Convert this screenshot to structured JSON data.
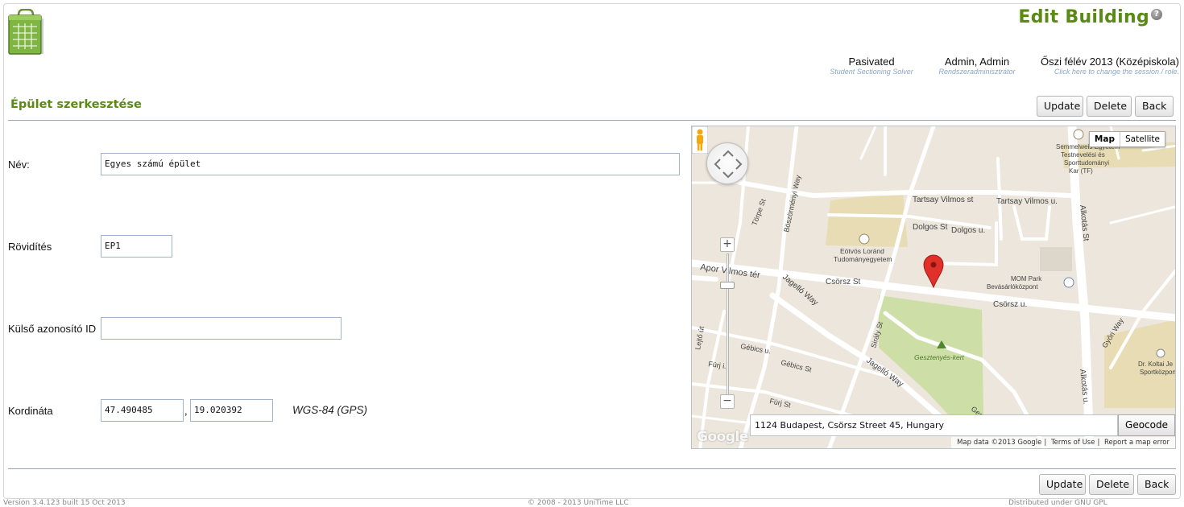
{
  "header": {
    "title": "Edit Building",
    "help_icon": "?",
    "blocks": [
      {
        "main": "Pasivated",
        "sub": "Student Sectioning Solver"
      },
      {
        "main": "Admin, Admin",
        "sub": "Rendszeradminisztrátor"
      },
      {
        "main": "Őszi félév 2013 (Középiskola)",
        "sub": "Click here to change the session / role."
      }
    ]
  },
  "section": {
    "title": "Épület szerkesztése"
  },
  "buttons": {
    "update": "Update",
    "delete": "Delete",
    "back": "Back"
  },
  "form": {
    "name_label": "Név:",
    "name_value": "Egyes számú épület",
    "abbr_label": "Rövidítés",
    "abbr_value": "EP1",
    "external_id_label": "Külső azonosító ID",
    "external_id_value": "",
    "coord_label": "Kordináta",
    "lat_value": "47.490485",
    "lng_value": "19.020392",
    "coord_separator": ",",
    "coord_system": "WGS-84 (GPS)"
  },
  "map": {
    "type_map": "Map",
    "type_satellite": "Satellite",
    "geocode_value": "1124 Budapest, Csörsz Street 45, Hungary",
    "geocode_button": "Geocode",
    "watermark": "Google",
    "attribution": [
      "Map data ©2013 Google",
      "Terms of Use",
      "Report a map error"
    ],
    "labels": {
      "tartsay1": "Tartsay Vilmos st",
      "tartsay2": "Tartsay Vilmos u.",
      "dolgos1": "Dolgos St",
      "dolgos2": "Dolgos u.",
      "alkotas1": "Alkotás St",
      "alkotas2": "Alkotás u.",
      "csorsz1": "Csörsz St",
      "csorsz2": "Csörsz u.",
      "apor": "Apor Vilmos tér",
      "jagello1": "Jagelló Way",
      "jagello2": "Jagelló Way",
      "boszormenyi": "Böszörményi Way",
      "torpe": "Törpe St",
      "gebics1": "Gébics u.",
      "gebics2": "Gébics St",
      "furj1": "Fürj i.",
      "furj2": "Fürj St",
      "siraly": "Sirály St",
      "gyori": "Győri Way",
      "gesztenyes_kert": "Gesztenyés-kert",
      "gesztenyes": "Gesztenyés",
      "elte1": "Eötvös Loránd",
      "elte2": "Tudományegyetem",
      "mom1": "MOM Park",
      "mom2": "Bevásárlóközpont",
      "semm1": "Semmelweis Egyetem",
      "semm2": "Testnevelési és",
      "semm3": "Sporttudományi",
      "semm4": "Kar (TF)",
      "koltai1": "Dr. Koltai Je",
      "koltai2": "Sportközpon",
      "lejto": "Lejtő út"
    }
  },
  "footer": {
    "left": "Version 3.4.123 built 15 Oct 2013",
    "center": "© 2008 - 2013 UniTime LLC",
    "right": "Distributed under GNU GPL"
  },
  "colors": {
    "title_green": "#5a8a14",
    "road": "#ffffff",
    "park": "#cddfa6",
    "campus": "#e8dcb4",
    "marker": "#e0302a"
  }
}
